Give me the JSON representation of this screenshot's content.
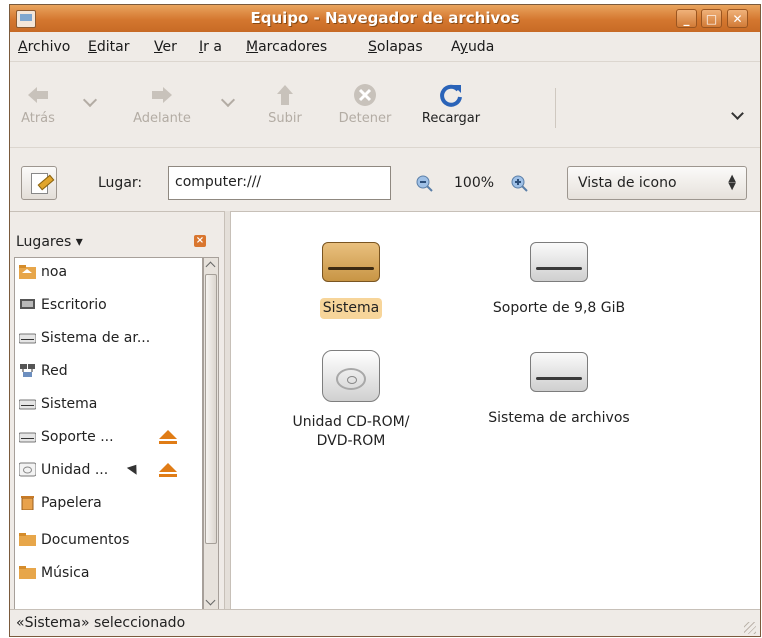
{
  "window": {
    "title": "Equipo - Navegador de archivos",
    "controls": [
      "_",
      "□",
      "✕"
    ]
  },
  "menu": {
    "items": [
      {
        "u": "A",
        "rest": "rchivo"
      },
      {
        "u": "E",
        "rest": "ditar"
      },
      {
        "u": "V",
        "rest": "er"
      },
      {
        "u": "I",
        "rest": "r a"
      },
      {
        "u": "M",
        "rest": "arcadores"
      },
      {
        "u": "S",
        "rest": "olapas"
      },
      {
        "pre": "A",
        "u": "y",
        "rest": "uda"
      }
    ]
  },
  "toolbar": {
    "back": "Atrás",
    "forward": "Adelante",
    "up": "Subir",
    "stop": "Detener",
    "reload": "Recargar"
  },
  "location": {
    "label": "Lugar:",
    "value": "computer:///",
    "zoom": "100%",
    "view": "Vista de icono"
  },
  "sidebar": {
    "header": "Lugares",
    "items": [
      {
        "label": "noa",
        "icon": "home-folder-icon"
      },
      {
        "label": "Escritorio",
        "icon": "desktop-icon"
      },
      {
        "label": "Sistema de ar...",
        "icon": "drive-icon"
      },
      {
        "label": "Red",
        "icon": "network-icon"
      },
      {
        "label": "Sistema",
        "icon": "drive-icon"
      },
      {
        "label": "Soporte ...",
        "icon": "drive-icon"
      },
      {
        "label": "Unidad ...",
        "icon": "cdrom-icon"
      },
      {
        "label": "Papelera",
        "icon": "trash-icon"
      },
      {
        "label": "Documentos",
        "icon": "folder-icon"
      },
      {
        "label": "Música",
        "icon": "folder-icon"
      }
    ]
  },
  "files": [
    {
      "label": "Sistema",
      "selected": true
    },
    {
      "label": "Soporte de 9,8 GiB",
      "selected": false
    },
    {
      "label_line1": "Unidad CD-ROM/",
      "label_line2": "DVD-ROM",
      "selected": false
    },
    {
      "label": "Sistema de archivos",
      "selected": false
    }
  ],
  "status": {
    "text": "«Sistema» seleccionado"
  },
  "colors": {
    "titlebar": "#d4772f",
    "selection": "#f7d59a",
    "window_bg": "#efebe7"
  }
}
